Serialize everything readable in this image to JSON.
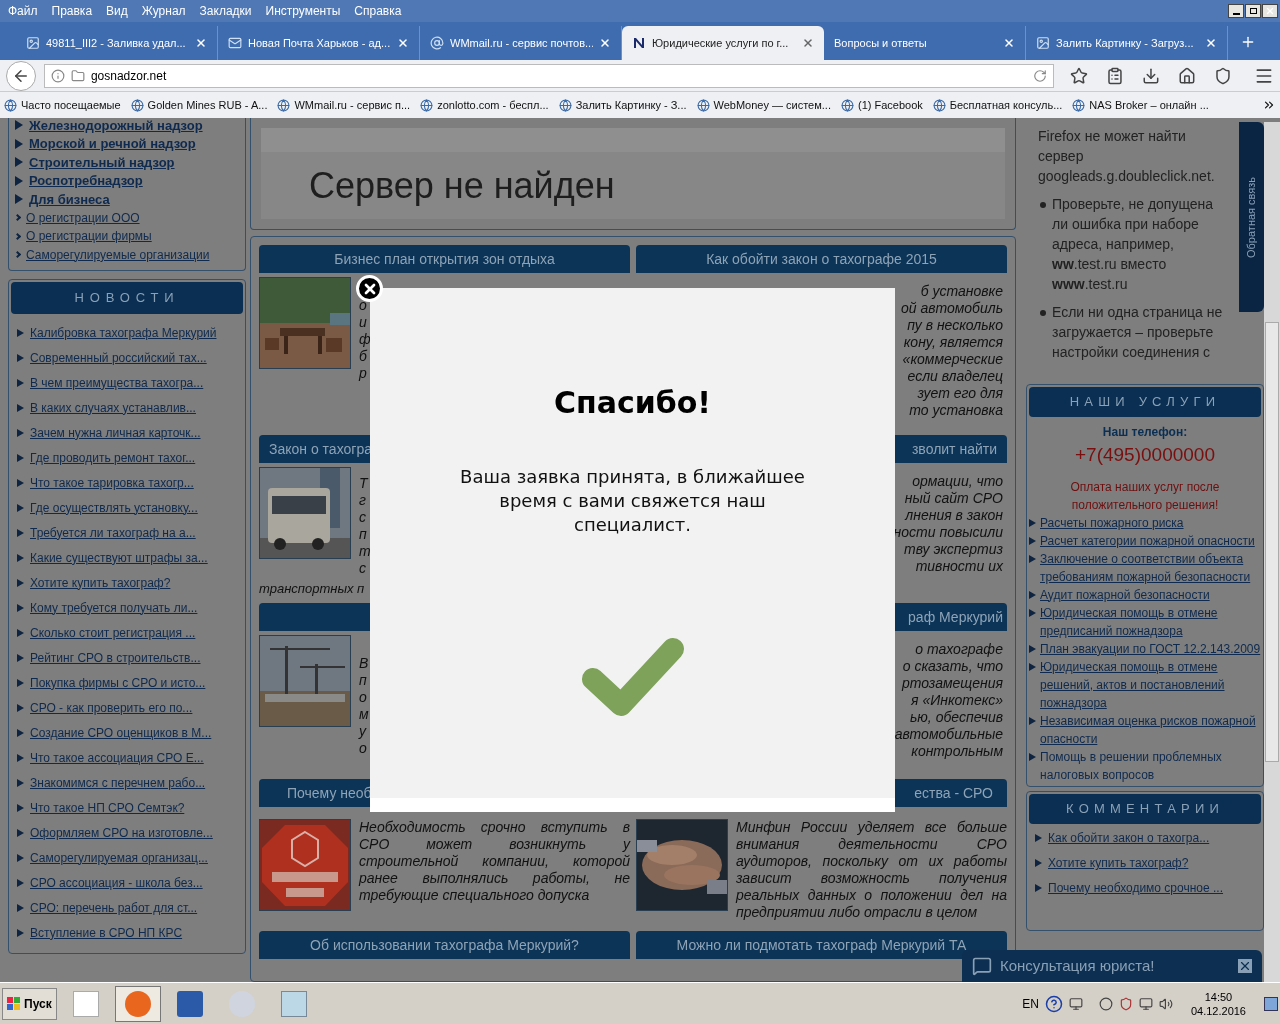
{
  "browser": {
    "menu": [
      "Файл",
      "Правка",
      "Вид",
      "Журнал",
      "Закладки",
      "Инструменты",
      "Справка"
    ],
    "tabs": [
      {
        "title": "49811_III2 - Заливка удал...",
        "selected": false
      },
      {
        "title": "Новая Почта Харьков - ад...",
        "selected": false
      },
      {
        "title": "WMmail.ru - сервис почтов...",
        "selected": false
      },
      {
        "title": "Юридические услуги по г...",
        "selected": true
      },
      {
        "title": "Вопросы и ответы",
        "selected": false
      },
      {
        "title": "Залить Картинку - Загруз...",
        "selected": false
      }
    ],
    "url": "gosnadzor.net",
    "bookmarks": [
      "Часто посещаемые",
      "Golden Mines RUB - A...",
      "WMmail.ru - сервис п...",
      "zonlotto.com - беспл...",
      "Залить Картинку - З...",
      "WebMoney — систем...",
      "(1) Facebook",
      "Бесплатная консуль...",
      "NAS Broker – онлайн ..."
    ]
  },
  "left_sidebar": {
    "top_links": [
      {
        "label": "Железнодорожный надзор",
        "kind": "main"
      },
      {
        "label": "Морской и речной надзор",
        "kind": "main"
      },
      {
        "label": "Строительный надзор",
        "kind": "main"
      },
      {
        "label": "Роспотребнадзор",
        "kind": "main"
      },
      {
        "label": "Для бизнеса",
        "kind": "main"
      },
      {
        "label": "О регистрации ООО",
        "kind": "sub"
      },
      {
        "label": "О регистрации фирмы",
        "kind": "sub"
      },
      {
        "label": "Саморегулируемые организации",
        "kind": "sub"
      }
    ],
    "news": {
      "title": "НОВОСТИ",
      "links": [
        "Калибровка тахографа Меркурий",
        "Современный российский тах...",
        "В чем преимущества тахогра...",
        "В каких случаях устанавлив...",
        "Зачем нужна личная карточк...",
        "Где проводить ремонт тахог...",
        "Что такое тарировка тахогр...",
        "Где осуществлять установку...",
        "Требуется ли тахограф на а...",
        "Какие существуют штрафы за...",
        "Хотите купить тахограф?",
        "Кому требуется получать ли...",
        "Сколько стоит регистрация ...",
        "Рейтинг СРО в строительств...",
        "Покупка фирмы с СРО и исто...",
        "СРО - как проверить его по...",
        "Создание СРО оценщиков в М...",
        "Что такое ассоциация СРО Е...",
        "Знакомимся с перечнем рабо...",
        "Что такое НП СРО Семтэк?",
        "Оформляем СРО на изготовле...",
        "Саморегулируемая организац...",
        "СРО ассоциация - школа без...",
        "СРО: перечень работ для ст...",
        "Вступление в СРО НП КРС"
      ]
    }
  },
  "error_banner": {
    "title": "Сервер не найден"
  },
  "article_rows": [
    {
      "left": {
        "title": "Бизнес план открытия зон отдыха",
        "lines": [
          "о",
          "и",
          "ф",
          "б",
          "р"
        ]
      },
      "right": {
        "title": "Как обойти закон о тахографе 2015",
        "lines": [
          "б установке",
          "ой автомобиль",
          "пу в несколько",
          "кону, является",
          "«коммерческие",
          "если владелец",
          "зует его для",
          "то установка"
        ]
      }
    },
    {
      "left": {
        "title": "Закон о тахогра",
        "lines": [
          "Т",
          "г",
          "с",
          "п",
          "т",
          "с"
        ],
        "tail": "транспортных п"
      },
      "right": {
        "title": "зволит найти",
        "lines": [
          "ормации, что",
          "ный сайт СРО",
          "лнения в закон",
          "ности повысили",
          "тву экспертиз",
          "тивности их"
        ]
      }
    },
    {
      "left": {
        "lines": [
          "В",
          "п",
          "о",
          "м",
          "у",
          "о"
        ]
      },
      "right": {
        "title": "раф Меркурий",
        "lines": [
          "о тахографе",
          "о сказать, что",
          "ртозамещения",
          "я «Инкотекс»",
          "ью, обеспечив",
          "автомобильные",
          "контрольным"
        ]
      }
    },
    {
      "left": {
        "title": "Почему необ",
        "text": "Необходимость срочно вступить в СРО может возникнуть у строительной компании, которой ранее выполнялись работы, не требующие специального допуска"
      },
      "right": {
        "title": "ества - СРО",
        "text": "Минфин России уделяет все больше внимания деятельности СРО аудиторов, поскольку от их работы зависит возможность получения реальных данных о положении дел на предприятии либо отрасли в целом"
      }
    },
    {
      "left": {
        "title": "Об использовании тахографа Меркурий?"
      },
      "right": {
        "title": "Можно ли подмотать тахограф Меркурий ТА"
      }
    }
  ],
  "modal": {
    "title": "Спасибо!",
    "message": "Ваша заявка принята, в ближайшее время с вами свяжется наш специалист."
  },
  "error_notice": {
    "text": "Firefox не может найти сервер googleads.g.doubleclick.net.",
    "bullets": [
      "Проверьте, не допущена ли ошибка при наборе адреса, например, **ww**.test.ru вместо **www**.test.ru",
      "Если ни одна страница не загружается – проверьте настройки соединения с"
    ]
  },
  "feedback_tab": "Обратная связь",
  "services": {
    "title": "НАШИ УСЛУГИ",
    "phone_label": "Наш телефон:",
    "phone": "+7(495)0000000",
    "payment_note": "Оплата наших услуг после положительного решения!",
    "links": [
      {
        "label": "Расчеты пожарного риска",
        "kind": "link"
      },
      {
        "label": "Расчет категории пожарной опасности",
        "kind": "link"
      },
      {
        "label": "Заключение о соответствии объекта требованиям пожарной безопасности",
        "kind": "link"
      },
      {
        "label": "Аудит пожарной безопасности",
        "kind": "link"
      },
      {
        "label": "Юридическая помощь в отмене предписаний пожнадзора",
        "kind": "link"
      },
      {
        "label": "План эвакуации по ГОСТ 12.2.143.2009",
        "kind": "link"
      },
      {
        "label": "Юридическая помощь в отмене решений, актов и постановлений пожнадзора",
        "kind": "link"
      },
      {
        "label": "Независимая оценка рисков пожарной опасности",
        "kind": "link"
      },
      {
        "label": "Помощь в решении проблемных налоговых вопросов",
        "kind": "plain"
      }
    ]
  },
  "comments": {
    "title": "КОММЕНТАРИИ",
    "links": [
      "Как обойти закон о тахогра...",
      "Хотите купить тахограф?",
      "Почему необходимо срочное ..."
    ]
  },
  "chat_widget": {
    "label": "Консультация юриста!"
  },
  "taskbar": {
    "start": "Пуск",
    "language": "EN",
    "time": "14:50",
    "date": "04.12.2016"
  }
}
